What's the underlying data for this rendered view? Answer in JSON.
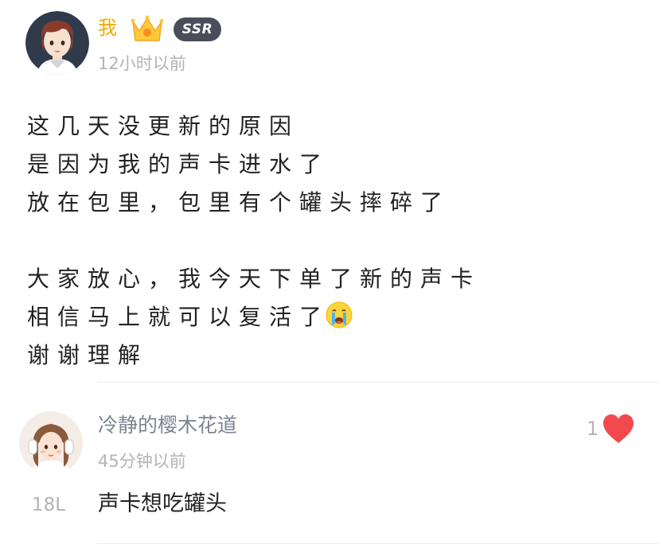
{
  "post": {
    "author": "我",
    "badge": "SSR",
    "time": "12小时以前",
    "lines": [
      "这几天没更新的原因",
      "是因为我的声卡进水了",
      "放在包里，包里有个罐头摔碎了",
      "",
      "大家放心，我今天下单了新的声卡",
      "相信马上就可以复活了",
      "谢谢理解"
    ],
    "emoji": "crying-face"
  },
  "comment": {
    "author": "冷静的樱木花道",
    "time": "45分钟以前",
    "likes": "1",
    "floor": "18L",
    "text": "声卡想吃罐头"
  },
  "colors": {
    "author_name": "#f2a900",
    "badge_bg": "#4a4e5a",
    "heart": "#f04a50",
    "muted": "#b3b3b3",
    "comment_author": "#7d8591"
  }
}
